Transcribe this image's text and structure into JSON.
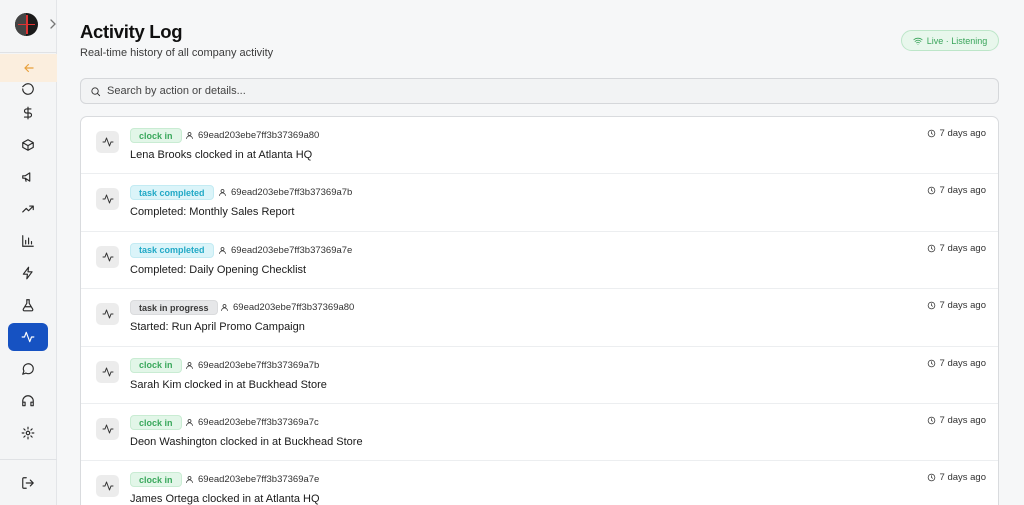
{
  "page": {
    "title": "Activity Log",
    "subtitle": "Real-time history of all company activity",
    "live_badge": "Live · Listening"
  },
  "search": {
    "placeholder": "Search by action or details..."
  },
  "colors": {
    "active_nav": "#1652c2",
    "badge_green": "#3aa85c",
    "badge_cyan": "#22a9c6",
    "badge_gray": "#3a3a3a",
    "back_highlight": "#fbeede"
  },
  "sidebar": {
    "items": [
      {
        "name": "refresh-icon",
        "active": false
      },
      {
        "name": "dollar-icon",
        "active": false
      },
      {
        "name": "package-icon",
        "active": false
      },
      {
        "name": "megaphone-icon",
        "active": false
      },
      {
        "name": "trending-up-icon",
        "active": false
      },
      {
        "name": "bar-chart-icon",
        "active": false
      },
      {
        "name": "zap-icon",
        "active": false
      },
      {
        "name": "flask-icon",
        "active": false
      },
      {
        "name": "activity-icon",
        "active": true
      },
      {
        "name": "message-icon",
        "active": false
      },
      {
        "name": "headphones-icon",
        "active": false
      },
      {
        "name": "settings-icon",
        "active": false
      }
    ]
  },
  "activities": [
    {
      "badge": "clock in",
      "type": "green",
      "user": "69ead203ebe7ff3b37369a80",
      "text": "Lena Brooks clocked in at Atlanta HQ",
      "time": "7 days ago"
    },
    {
      "badge": "task completed",
      "type": "cyan",
      "user": "69ead203ebe7ff3b37369a7b",
      "text": "Completed: Monthly Sales Report",
      "time": "7 days ago"
    },
    {
      "badge": "task completed",
      "type": "cyan",
      "user": "69ead203ebe7ff3b37369a7e",
      "text": "Completed: Daily Opening Checklist",
      "time": "7 days ago"
    },
    {
      "badge": "task in progress",
      "type": "gray",
      "user": "69ead203ebe7ff3b37369a80",
      "text": "Started: Run April Promo Campaign",
      "time": "7 days ago"
    },
    {
      "badge": "clock in",
      "type": "green",
      "user": "69ead203ebe7ff3b37369a7b",
      "text": "Sarah Kim clocked in at Buckhead Store",
      "time": "7 days ago"
    },
    {
      "badge": "clock in",
      "type": "green",
      "user": "69ead203ebe7ff3b37369a7c",
      "text": "Deon Washington clocked in at Buckhead Store",
      "time": "7 days ago"
    },
    {
      "badge": "clock in",
      "type": "green",
      "user": "69ead203ebe7ff3b37369a7e",
      "text": "James Ortega clocked in at Atlanta HQ",
      "time": "7 days ago"
    }
  ]
}
